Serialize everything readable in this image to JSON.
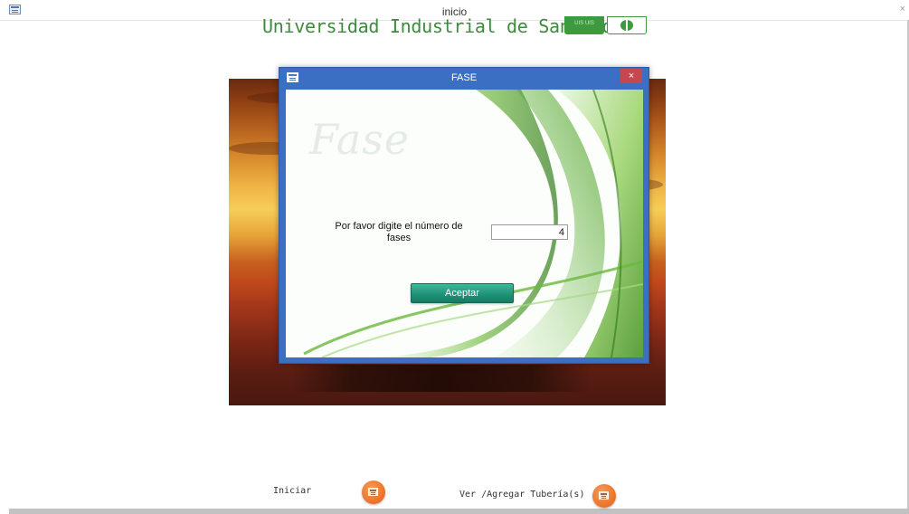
{
  "window": {
    "title": "inicio",
    "close_glyph": "×",
    "icon": "form-icon"
  },
  "header": {
    "university_title": "Universidad Industrial de Santander",
    "logo_small_text": "UIS UIS"
  },
  "dialog": {
    "title": "FASE",
    "close_glyph": "×",
    "watermark": "Fase",
    "prompt_label": "Por favor digite el número de fases",
    "input_value": "4",
    "accept_label": "Aceptar"
  },
  "bottom": {
    "iniciar_label": "Iniciar",
    "ver_label": "Ver /Agregar Tubería(s)"
  },
  "colors": {
    "dialog_border": "#3a6fc4",
    "university_green": "#3e8a3e",
    "accept_button": "#1f9478",
    "orange_button": "#ee7a30",
    "close_button": "#c4484f"
  }
}
